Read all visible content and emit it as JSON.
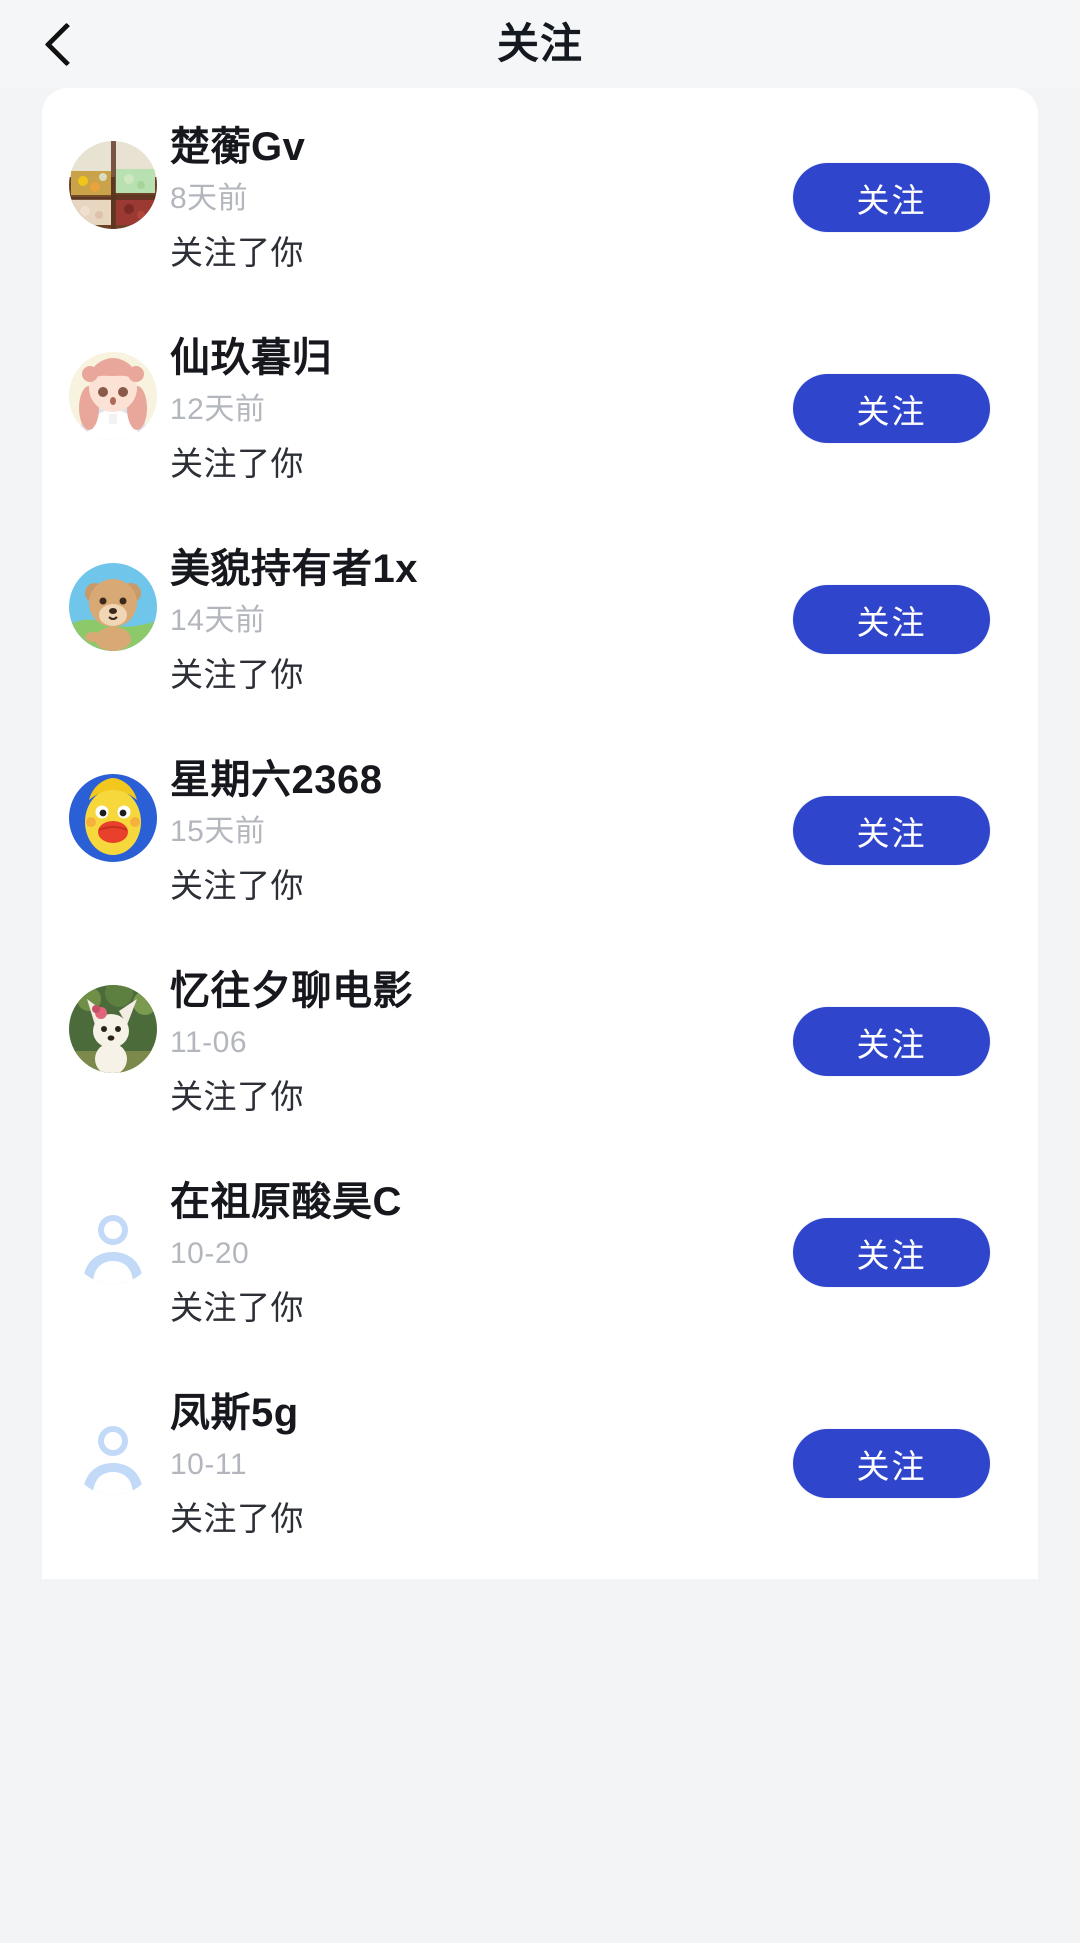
{
  "header": {
    "back_icon": "chevron-left-icon",
    "title": "关注"
  },
  "list": {
    "items": [
      {
        "name": "楚蘅Gv",
        "time": "8天前",
        "action": "关注了你",
        "follow_label": "关注",
        "avatar_type": "photo-food"
      },
      {
        "name": "仙玖暮归",
        "time": "12天前",
        "action": "关注了你",
        "follow_label": "关注",
        "avatar_type": "anime-girl"
      },
      {
        "name": "美貌持有者1x",
        "time": "14天前",
        "action": "关注了你",
        "follow_label": "关注",
        "avatar_type": "cartoon-bear"
      },
      {
        "name": "星期六2368",
        "time": "15天前",
        "action": "关注了你",
        "follow_label": "关注",
        "avatar_type": "cartoon-duck"
      },
      {
        "name": "忆往夕聊电影",
        "time": "11-06",
        "action": "关注了你",
        "follow_label": "关注",
        "avatar_type": "photo-dog"
      },
      {
        "name": "在祖原酸昊C",
        "time": "10-20",
        "action": "关注了你",
        "follow_label": "关注",
        "avatar_type": "default-placeholder"
      },
      {
        "name": "凤斯5g",
        "time": "10-11",
        "action": "关注了你",
        "follow_label": "关注",
        "avatar_type": "default-placeholder"
      }
    ]
  },
  "colors": {
    "page_background": "#f3f4f6",
    "card_background": "#ffffff",
    "accent_blue": "#2f46cc",
    "title_text": "#14181f",
    "name_text": "#16181d",
    "time_text": "#b3b6bc",
    "action_text": "#2c2f36",
    "placeholder_avatar": "#b9d3f5"
  }
}
